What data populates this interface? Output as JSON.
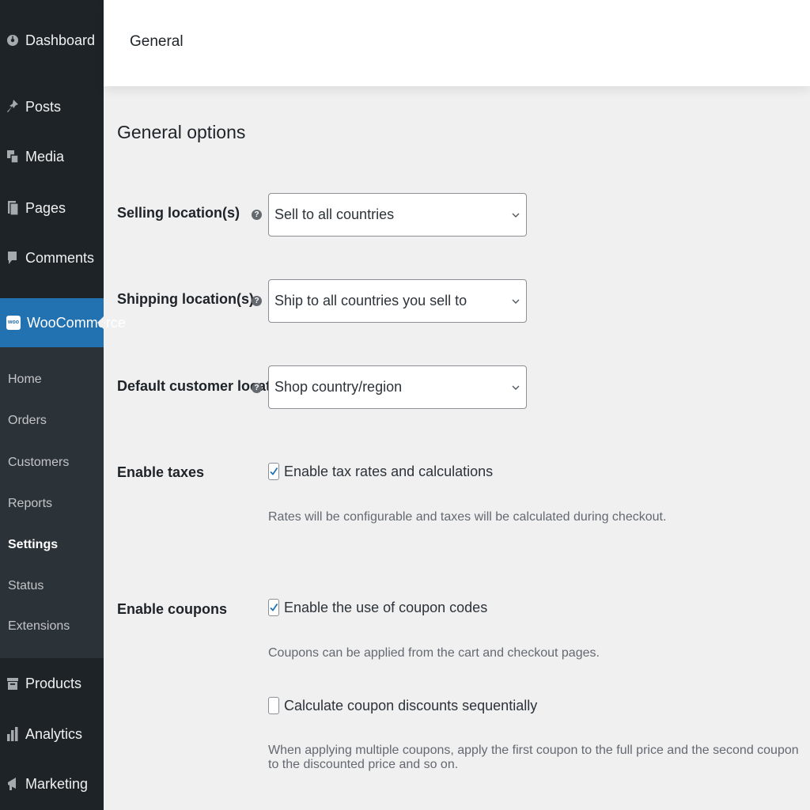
{
  "sidebar": {
    "top_items": [
      {
        "label": "Dashboard",
        "icon": "dashboard-icon"
      },
      {
        "label": "Posts",
        "icon": "pin-icon"
      },
      {
        "label": "Media",
        "icon": "media-icon"
      },
      {
        "label": "Pages",
        "icon": "pages-icon"
      },
      {
        "label": "Comments",
        "icon": "comment-icon"
      }
    ],
    "active_item": {
      "label": "WooCommerce",
      "icon": "woo-icon",
      "icon_text": "woo"
    },
    "submenu": [
      "Home",
      "Orders",
      "Customers",
      "Reports",
      "Settings",
      "Status",
      "Extensions"
    ],
    "current_submenu": "Settings",
    "bottom_items": [
      {
        "label": "Products",
        "icon": "archive-icon"
      },
      {
        "label": "Analytics",
        "icon": "bar-chart-icon"
      },
      {
        "label": "Marketing",
        "icon": "megaphone-icon"
      }
    ]
  },
  "header": {
    "title": "General"
  },
  "main": {
    "section_title": "General options",
    "help_glyph": "?",
    "fields": [
      {
        "label": "Selling location(s)",
        "value": "Sell to all countries"
      },
      {
        "label": "Shipping location(s)",
        "value": "Ship to all countries you sell to"
      },
      {
        "label": "Default customer location",
        "value": "Shop country/region"
      }
    ],
    "taxes": {
      "label": "Enable taxes",
      "checkbox_label": "Enable tax rates and calculations",
      "checked": true,
      "description": "Rates will be configurable and taxes will be calculated during checkout."
    },
    "coupons": {
      "label": "Enable coupons",
      "checkbox_label": "Enable the use of coupon codes",
      "checked": true,
      "description": "Coupons can be applied from the cart and checkout pages.",
      "sequential_label": "Calculate coupon discounts sequentially",
      "sequential_checked": false,
      "sequential_description": "When applying multiple coupons, apply the first coupon to the full price and the second coupon to the discounted price and so on."
    }
  },
  "colors": {
    "sidebar_bg": "#1d2327",
    "submenu_bg": "#2c3338",
    "accent": "#2271b1",
    "content_bg": "#f0f0f1"
  }
}
